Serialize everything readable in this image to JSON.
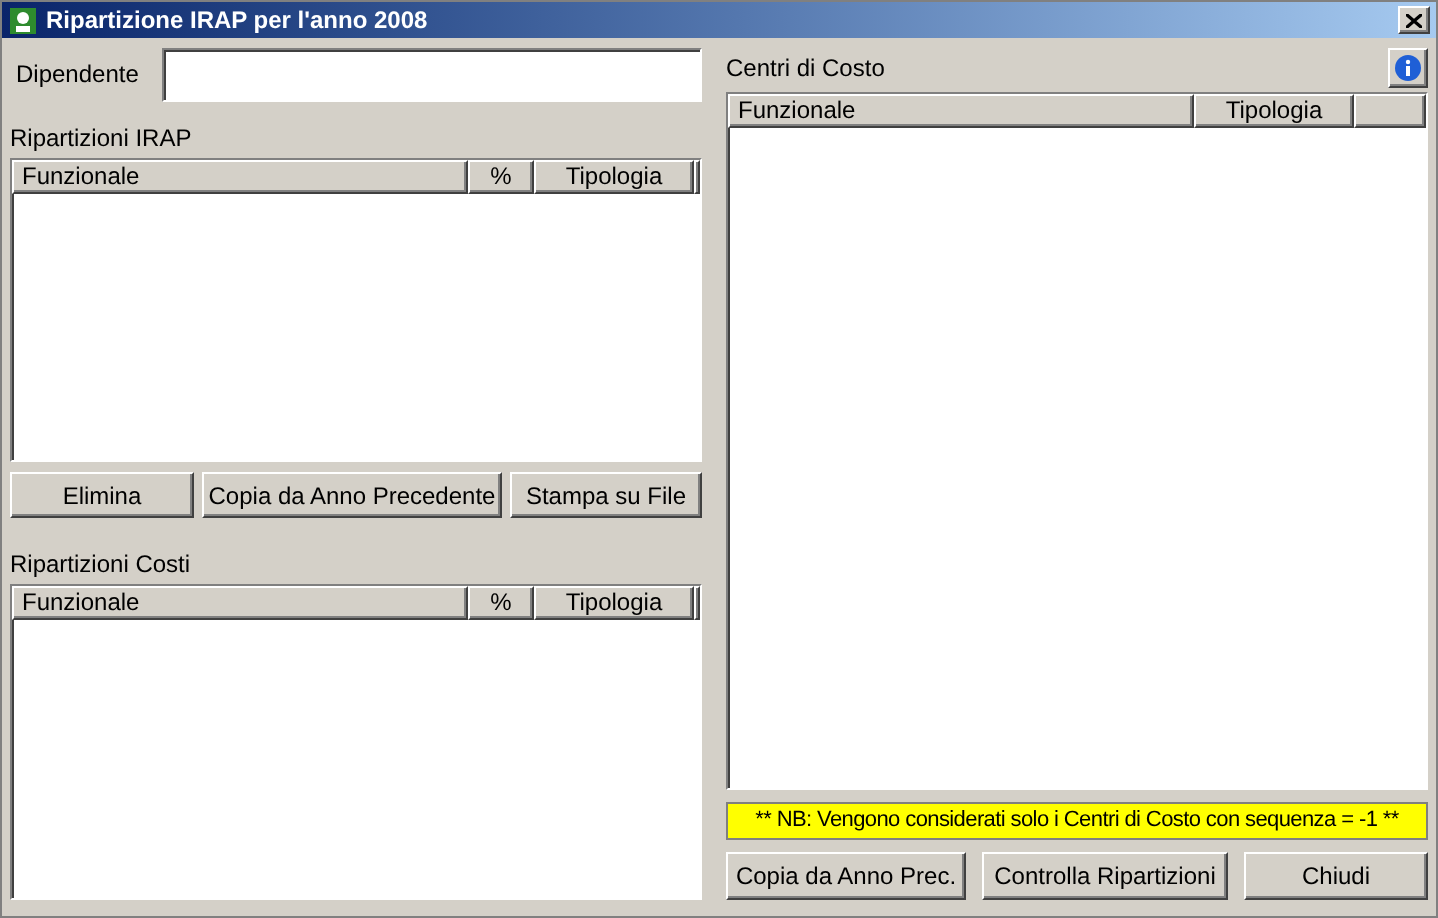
{
  "window": {
    "title": "Ripartizione IRAP per l'anno 2008"
  },
  "employee": {
    "label": "Dipendente"
  },
  "irap": {
    "title": "Ripartizioni IRAP",
    "columns": [
      "Funzionale",
      "%",
      "Tipologia"
    ]
  },
  "irap_buttons": [
    "Elimina",
    "Copia da Anno Precedente",
    "Stampa su File"
  ],
  "costs": {
    "title": "Ripartizioni Costi",
    "columns": [
      "Funzionale",
      "%",
      "Tipologia"
    ]
  },
  "cost_centers": {
    "title": "Centri di Costo",
    "columns": [
      "Funzionale",
      "Tipologia"
    ]
  },
  "note": "** NB: Vengono considerati solo i Centri di Costo con sequenza = -1 **",
  "buttons": [
    "Copia da Anno Prec.",
    "Controlla Ripartizioni",
    "Chiudi"
  ]
}
